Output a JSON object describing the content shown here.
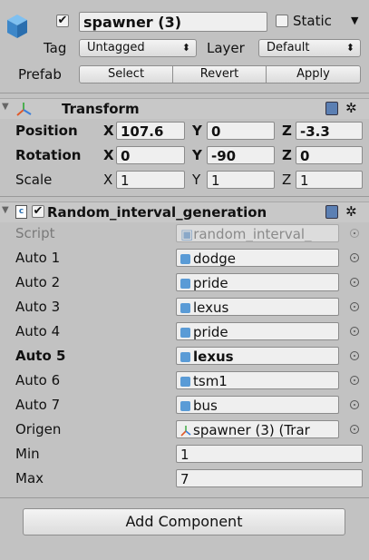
{
  "object": {
    "name": "spawner (3)",
    "active": true,
    "static_label": "Static",
    "tag_label": "Tag",
    "tag_value": "Untagged",
    "layer_label": "Layer",
    "layer_value": "Default",
    "prefab_label": "Prefab",
    "prefab_buttons": [
      "Select",
      "Revert",
      "Apply"
    ]
  },
  "transform": {
    "title": "Transform",
    "rows": [
      {
        "label": "Position",
        "bold": true,
        "x": "107.6",
        "y": "0",
        "z": "-3.3"
      },
      {
        "label": "Rotation",
        "bold": true,
        "x": "0",
        "y": "-90",
        "z": "0"
      },
      {
        "label": "Scale",
        "bold": false,
        "x": "1",
        "y": "1",
        "z": "1"
      }
    ],
    "axis_labels": [
      "X",
      "Y",
      "Z"
    ]
  },
  "component": {
    "title": "Random_interval_generation",
    "script_label": "Script",
    "script_value": "random_interval_",
    "fields": [
      {
        "label": "Auto 1",
        "value": "dodge"
      },
      {
        "label": "Auto 2",
        "value": "pride"
      },
      {
        "label": "Auto 3",
        "value": "lexus"
      },
      {
        "label": "Auto 4",
        "value": "pride"
      },
      {
        "label": "Auto 5",
        "value": "lexus"
      },
      {
        "label": "Auto 6",
        "value": "tsm1"
      },
      {
        "label": "Auto 7",
        "value": "bus"
      }
    ],
    "origen_label": "Origen",
    "origen_value": "spawner (3) (Trar",
    "min_label": "Min",
    "min_value": "1",
    "max_label": "Max",
    "max_value": "7"
  },
  "add_component_label": "Add Component",
  "colors": {
    "background": "#c2c2c2",
    "field": "#efefef",
    "prefab_cube": "#5a9bd6"
  }
}
